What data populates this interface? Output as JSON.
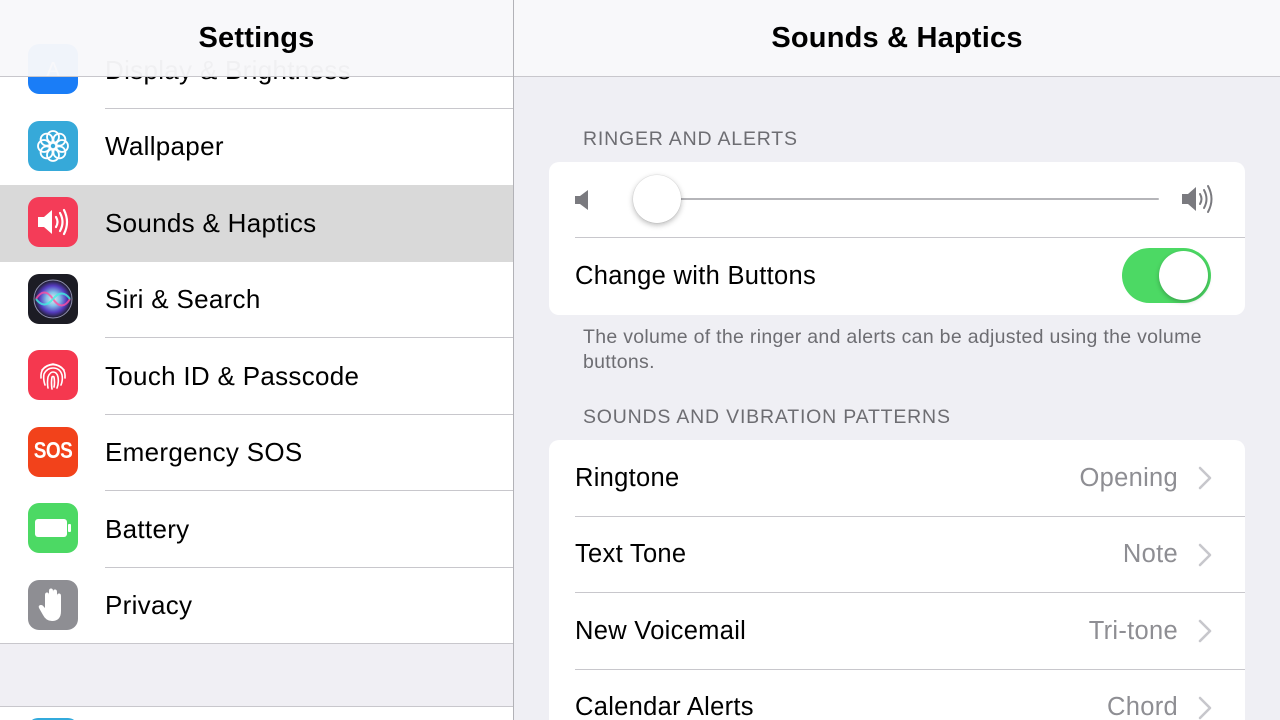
{
  "master": {
    "title": "Settings",
    "items": [
      {
        "label": "Display & Brightness",
        "icon": "display-brightness-icon",
        "color": "#1a7df7"
      },
      {
        "label": "Wallpaper",
        "icon": "wallpaper-icon",
        "color": "#36a9d9"
      },
      {
        "label": "Sounds & Haptics",
        "icon": "speaker-icon",
        "color": "#f43c58",
        "selected": true
      },
      {
        "label": "Siri & Search",
        "icon": "siri-icon",
        "color": "#1c1c24"
      },
      {
        "label": "Touch ID & Passcode",
        "icon": "fingerprint-icon",
        "color": "#f5384f"
      },
      {
        "label": "Emergency SOS",
        "icon": "sos-icon",
        "color": "#f2421b",
        "icon_text": "SOS"
      },
      {
        "label": "Battery",
        "icon": "battery-icon",
        "color": "#4cd964"
      },
      {
        "label": "Privacy",
        "icon": "hand-icon",
        "color": "#8e8e93"
      }
    ]
  },
  "detail": {
    "title": "Sounds & Haptics",
    "ringer_section": {
      "header": "RINGER AND ALERTS",
      "slider_value": 0.0,
      "change_with_buttons_label": "Change with Buttons",
      "change_with_buttons_on": true,
      "footer": "The volume of the ringer and alerts can be adjusted using the volume buttons."
    },
    "patterns_section": {
      "header": "SOUNDS AND VIBRATION PATTERNS",
      "rows": [
        {
          "label": "Ringtone",
          "value": "Opening"
        },
        {
          "label": "Text Tone",
          "value": "Note"
        },
        {
          "label": "New Voicemail",
          "value": "Tri-tone"
        },
        {
          "label": "Calendar Alerts",
          "value": "Chord"
        }
      ]
    }
  },
  "colors": {
    "toggle_on": "#4cd964",
    "selection": "#d9d9d9",
    "secondary_text": "#8e8e93",
    "section_text": "#6d6d72"
  }
}
